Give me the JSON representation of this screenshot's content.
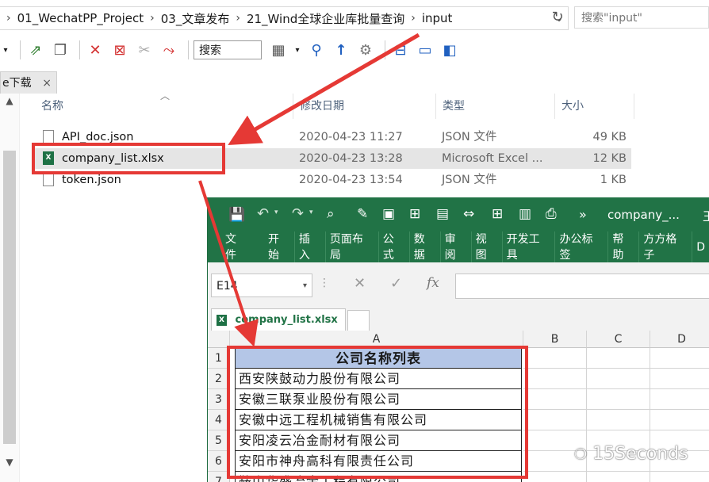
{
  "address": {
    "crumbs": [
      "01_WechatPP_Project",
      "03_文章发布",
      "21_Wind全球企业库批量查询",
      "input"
    ],
    "search_placeholder": "搜索\"input\""
  },
  "toolbar": {
    "search_label": "搜索"
  },
  "tab": {
    "label": "e下载",
    "close": "×"
  },
  "file_list": {
    "headers": {
      "name": "名称",
      "date": "修改日期",
      "type": "类型",
      "size": "大小"
    },
    "files": [
      {
        "name": "API_doc.json",
        "date": "2020-04-23 11:27",
        "type": "JSON 文件",
        "size": "49 KB",
        "icon": "json-file-icon"
      },
      {
        "name": "company_list.xlsx",
        "date": "2020-04-23 13:28",
        "type": "Microsoft Excel ...",
        "size": "12 KB",
        "icon": "excel-file-icon"
      },
      {
        "name": "token.json",
        "date": "2020-04-23 13:54",
        "type": "JSON 文件",
        "size": "1 KB",
        "icon": "json-file-icon"
      }
    ]
  },
  "excel": {
    "title": "company_...",
    "title_extra": "王",
    "ribbon": [
      "文件",
      "开始",
      "插入",
      "页面布局",
      "公式",
      "数据",
      "审阅",
      "视图",
      "开发工具",
      "办公标签",
      "帮助",
      "方方格子",
      "D"
    ],
    "name_box": "E14",
    "sheet_tab": "company_list.xlsx",
    "columns": [
      "A",
      "B",
      "C",
      "D"
    ],
    "rows": [
      {
        "num": "1",
        "value": "公司名称列表"
      },
      {
        "num": "2",
        "value": "西安陕鼓动力股份有限公司"
      },
      {
        "num": "3",
        "value": "安徽三联泵业股份有限公司"
      },
      {
        "num": "4",
        "value": "安徽中远工程机械销售有限公司"
      },
      {
        "num": "5",
        "value": "安阳凌云冶金耐材有限公司"
      },
      {
        "num": "6",
        "value": "安阳市神舟高科有限责任公司"
      },
      {
        "num": "7",
        "value": "鞍山华盛冶金工程有限公司"
      }
    ]
  },
  "watermark": "15Seconds",
  "colors": {
    "excel_green": "#217346",
    "highlight_red": "#e53935",
    "header_blue": "#b4c6e7"
  }
}
